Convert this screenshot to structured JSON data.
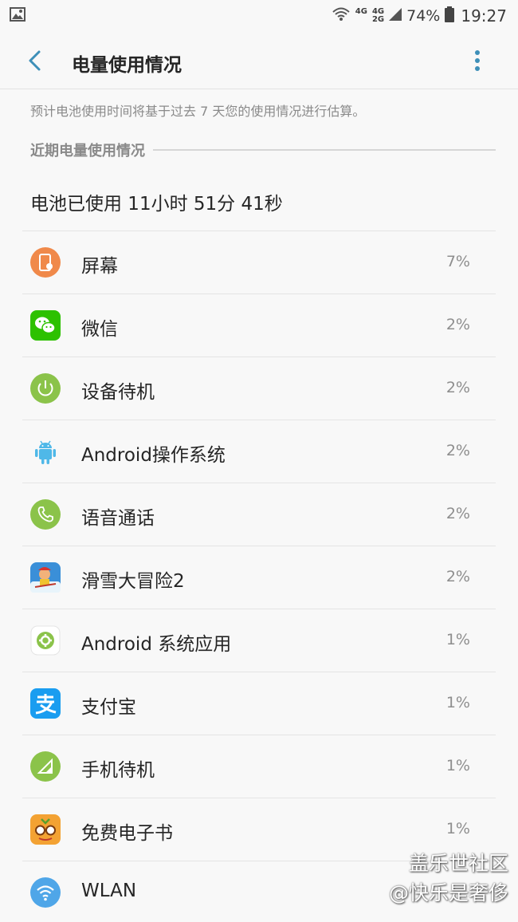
{
  "status_bar": {
    "net_top": "4G",
    "net_bottom_a": "4G",
    "net_bottom_b": "2G",
    "battery": "74%",
    "time": "19:27"
  },
  "header": {
    "title": "电量使用情况"
  },
  "subtitle": "预计电池使用时间将基于过去 7 天您的使用情况进行估算。",
  "section_label": "近期电量使用情况",
  "summary": "电池已使用 11小时 51分 41秒",
  "items": [
    {
      "name": "屏幕",
      "percent": "7%",
      "icon": "screen-icon",
      "color": "#f0894a"
    },
    {
      "name": "微信",
      "percent": "2%",
      "icon": "wechat-icon",
      "color": "#2dc100"
    },
    {
      "name": "设备待机",
      "percent": "2%",
      "icon": "power-icon",
      "color": "#8bc34a"
    },
    {
      "name": "Android操作系统",
      "percent": "2%",
      "icon": "android-icon",
      "color": "#4fb8e8"
    },
    {
      "name": "语音通话",
      "percent": "2%",
      "icon": "phone-icon",
      "color": "#8bc34a"
    },
    {
      "name": "滑雪大冒险2",
      "percent": "2%",
      "icon": "ski-game-icon",
      "color": "#3a8fd8"
    },
    {
      "name": "Android 系统应用",
      "percent": "1%",
      "icon": "gear-icon",
      "color": "#8bc34a"
    },
    {
      "name": "支付宝",
      "percent": "1%",
      "icon": "alipay-icon",
      "color": "#1a9df0"
    },
    {
      "name": "手机待机",
      "percent": "1%",
      "icon": "signal-icon",
      "color": "#8bc34a"
    },
    {
      "name": "免费电子书",
      "percent": "1%",
      "icon": "ebook-icon",
      "color": "#f3a233"
    },
    {
      "name": "WLAN",
      "percent": "",
      "icon": "wifi-icon",
      "color": "#4fa6e8"
    }
  ],
  "watermark": {
    "line1": "盖乐世社区",
    "line2": "@快乐是奢侈"
  }
}
